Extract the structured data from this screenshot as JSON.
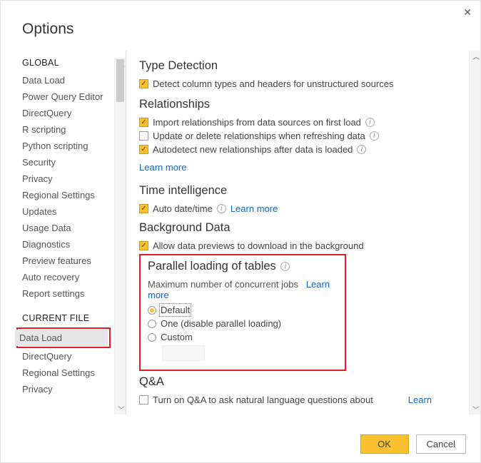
{
  "dialog": {
    "title": "Options"
  },
  "sidebar": {
    "global_heading": "GLOBAL",
    "global_items": [
      "Data Load",
      "Power Query Editor",
      "DirectQuery",
      "R scripting",
      "Python scripting",
      "Security",
      "Privacy",
      "Regional Settings",
      "Updates",
      "Usage Data",
      "Diagnostics",
      "Preview features",
      "Auto recovery",
      "Report settings"
    ],
    "current_heading": "CURRENT FILE",
    "current_items": [
      "Data Load",
      "DirectQuery",
      "Regional Settings",
      "Privacy"
    ]
  },
  "sections": {
    "type_detection": {
      "title": "Type Detection",
      "opt1": "Detect column types and headers for unstructured sources"
    },
    "relationships": {
      "title": "Relationships",
      "opt1": "Import relationships from data sources on first load",
      "opt2": "Update or delete relationships when refreshing data",
      "opt3": "Autodetect new relationships after data is loaded",
      "learn": "Learn more"
    },
    "time": {
      "title": "Time intelligence",
      "opt1": "Auto date/time",
      "learn": "Learn more"
    },
    "bg": {
      "title": "Background Data",
      "opt1": "Allow data previews to download in the background"
    },
    "parallel": {
      "title": "Parallel loading of tables",
      "sub": "Maximum number of concurrent jobs",
      "learn": "Learn more",
      "r1": "Default",
      "r2": "One (disable parallel loading)",
      "r3": "Custom"
    },
    "qna": {
      "title": "Q&A",
      "opt1": "Turn on Q&A to ask natural language questions about",
      "learn": "Learn"
    }
  },
  "buttons": {
    "ok": "OK",
    "cancel": "Cancel"
  }
}
